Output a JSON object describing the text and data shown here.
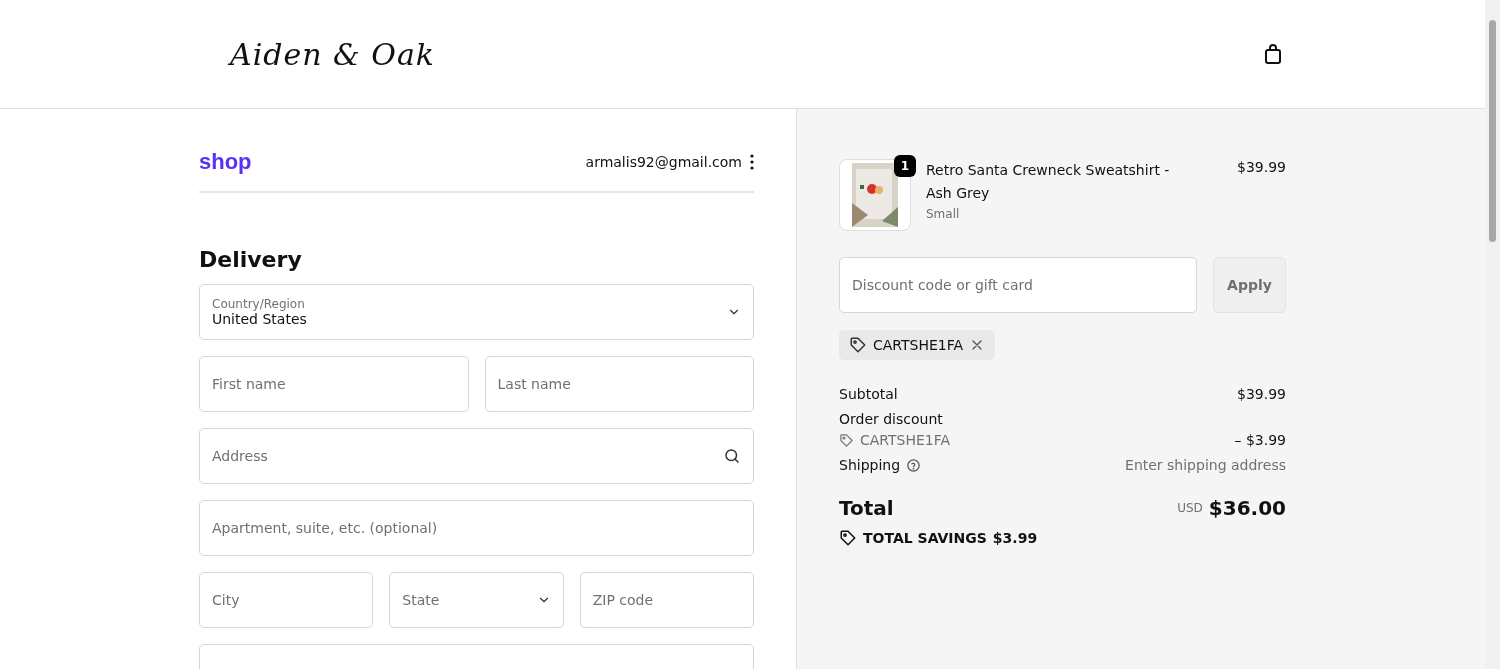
{
  "header": {
    "logo": "Aiden & Oak"
  },
  "account": {
    "brand": "shop",
    "email": "armalis92@gmail.com"
  },
  "delivery": {
    "title": "Delivery",
    "rows": [
      [
        {
          "kind": "select",
          "label": "Country/Region",
          "value": "United States"
        }
      ],
      [
        {
          "kind": "input",
          "placeholder": "First name"
        },
        {
          "kind": "input",
          "placeholder": "Last name"
        }
      ],
      [
        {
          "kind": "search",
          "placeholder": "Address"
        }
      ],
      [
        {
          "kind": "input",
          "placeholder": "Apartment, suite, etc. (optional)"
        }
      ],
      [
        {
          "kind": "input",
          "placeholder": "City"
        },
        {
          "kind": "select",
          "placeholder": "State"
        },
        {
          "kind": "input",
          "placeholder": "ZIP code"
        }
      ],
      [
        {
          "kind": "input"
        }
      ]
    ]
  },
  "cart": {
    "item": {
      "quantity": "1",
      "name": "Retro Santa Crewneck Sweatshirt - Ash Grey",
      "variant": "Small",
      "price": "$39.99"
    },
    "discount": {
      "placeholder": "Discount code or gift card",
      "button": "Apply",
      "applied_code": "CARTSHE1FA"
    },
    "summary": {
      "subtotal_label": "Subtotal",
      "subtotal": "$39.99",
      "discount_label": "Order discount",
      "discount_code": "CARTSHE1FA",
      "discount_amount": "– $3.99",
      "shipping_label": "Shipping",
      "shipping_value": "Enter shipping address",
      "total_label": "Total",
      "currency": "USD",
      "total": "$36.00",
      "savings_label": "TOTAL SAVINGS",
      "savings": "$3.99"
    }
  }
}
